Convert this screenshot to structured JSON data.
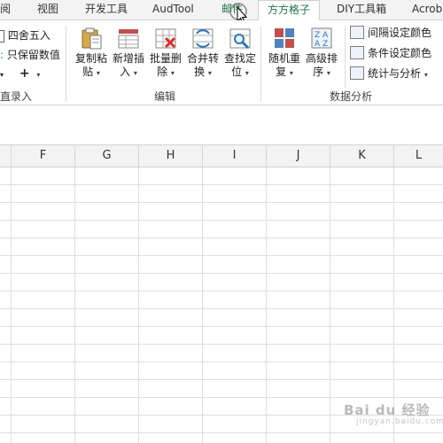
{
  "tabs": [
    {
      "label": "阅"
    },
    {
      "label": "视图"
    },
    {
      "label": "开发工具"
    },
    {
      "label": "AudTool"
    },
    {
      "label": "邮件"
    },
    {
      "label": "方方格子"
    },
    {
      "label": "DIY工具箱"
    },
    {
      "label": "Acrob"
    }
  ],
  "active_tab": "方方格子",
  "left_group": {
    "row1": "四舍五入",
    "row2": "只保留数值",
    "row3_plus": "+",
    "label": "直录入"
  },
  "edit_group": {
    "label": "编辑",
    "buttons": [
      {
        "line1": "复制粘",
        "line2": "贴"
      },
      {
        "line1": "新增插",
        "line2": "入"
      },
      {
        "line1": "批量删",
        "line2": "除"
      },
      {
        "line1": "合并转",
        "line2": "换"
      },
      {
        "line1": "查找定",
        "line2": "位"
      }
    ]
  },
  "analysis_group": {
    "label": "数据分析",
    "buttons": [
      {
        "line1": "随机重",
        "line2": "复"
      },
      {
        "line1": "高级排",
        "line2": "序"
      }
    ],
    "rows": [
      {
        "label": "间隔设定颜色"
      },
      {
        "label": "条件设定颜色"
      },
      {
        "label": "统计与分析"
      }
    ]
  },
  "columns": [
    "F",
    "G",
    "H",
    "I",
    "J",
    "K",
    "L"
  ],
  "watermark": {
    "text": "Bai du 经验",
    "sub": "jingyan.baidu.com"
  },
  "colors": {
    "accent": "#217346"
  }
}
